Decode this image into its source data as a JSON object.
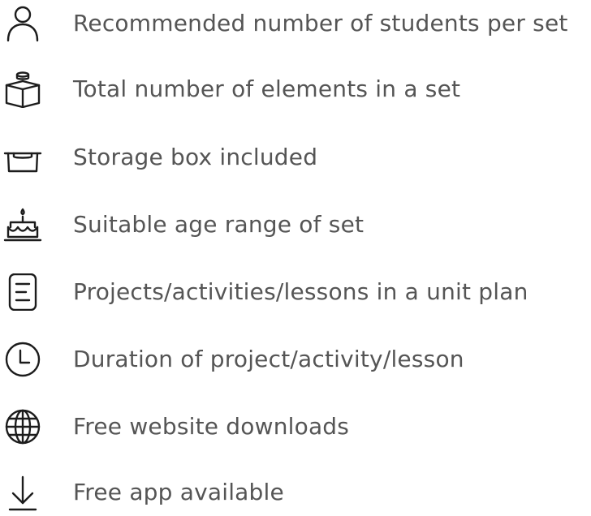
{
  "legend": {
    "items": [
      {
        "icon": "person-icon",
        "label": "Recommended number of students per set"
      },
      {
        "icon": "brick-box-icon",
        "label": "Total number of elements in a set"
      },
      {
        "icon": "storage-box-icon",
        "label": "Storage box included"
      },
      {
        "icon": "birthday-cake-icon",
        "label": "Suitable age range of set"
      },
      {
        "icon": "document-icon",
        "label": "Projects/activities/lessons in a unit plan"
      },
      {
        "icon": "clock-icon",
        "label": "Duration of project/activity/lesson"
      },
      {
        "icon": "globe-icon",
        "label": "Free website downloads"
      },
      {
        "icon": "download-arrow-icon",
        "label": "Free app available"
      }
    ]
  }
}
